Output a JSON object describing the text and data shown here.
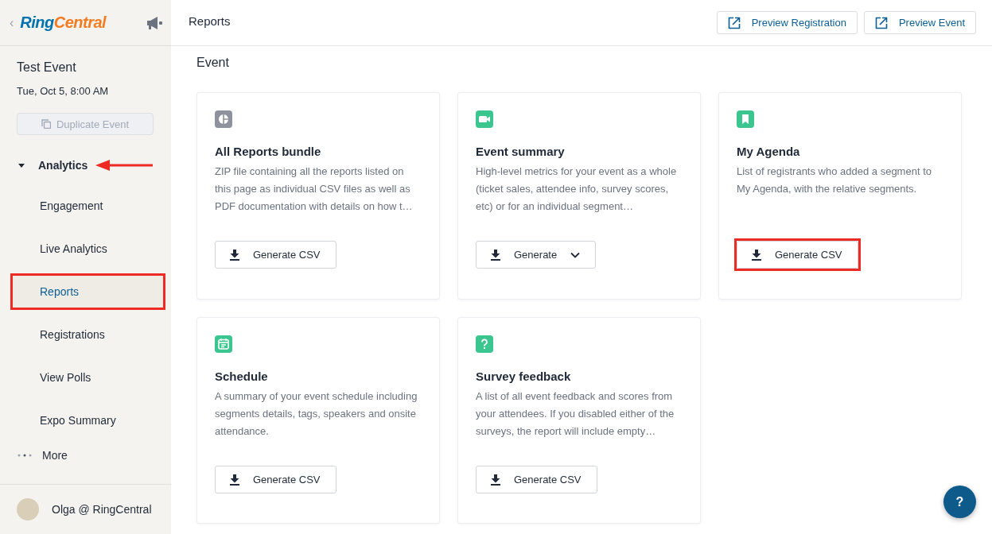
{
  "sidebar": {
    "back_label": "‹",
    "logo": {
      "primary": "Ring",
      "secondary": "Central"
    },
    "event": {
      "title": "Test Event",
      "date": "Tue, Oct 5, 8:00 AM"
    },
    "duplicate_button": {
      "label": "Duplicate Event",
      "disabled": true
    },
    "section": {
      "label": "Analytics",
      "expanded": true,
      "arrow_annotation": true,
      "items": [
        {
          "label": "Engagement",
          "selected": false,
          "annotated": false
        },
        {
          "label": "Live Analytics",
          "selected": false,
          "annotated": false
        },
        {
          "label": "Reports",
          "selected": true,
          "annotated": true
        },
        {
          "label": "Registrations",
          "selected": false,
          "annotated": false
        },
        {
          "label": "View Polls",
          "selected": false,
          "annotated": false
        },
        {
          "label": "Expo Summary",
          "selected": false,
          "annotated": false
        }
      ]
    },
    "more": {
      "label": "More"
    },
    "user": {
      "name": "Olga @ RingCentral"
    }
  },
  "header": {
    "title": "Reports",
    "buttons": [
      {
        "label": "Preview Registration"
      },
      {
        "label": "Preview Event"
      }
    ]
  },
  "section_title": "Event",
  "cards": [
    {
      "title": "All Reports bundle",
      "description": "ZIP file containing all the reports listed on this page as individual CSV files as well as PDF documentation with details on how t…",
      "button": {
        "label": "Generate CSV",
        "dropdown": false,
        "annotated": false
      }
    },
    {
      "title": "Event summary",
      "description": "High-level metrics for your event as a whole (ticket sales, attendee info, survey scores, etc) or for an individual segment…",
      "button": {
        "label": "Generate",
        "dropdown": true,
        "annotated": false
      }
    },
    {
      "title": "My Agenda",
      "description": "List of registrants who added a segment to My Agenda, with the relative segments.",
      "button": {
        "label": "Generate CSV",
        "dropdown": false,
        "annotated": true
      }
    },
    {
      "title": "Schedule",
      "description": "A summary of your event schedule including segments details, tags, speakers and onsite attendance.",
      "button": {
        "label": "Generate CSV",
        "dropdown": false,
        "annotated": false
      }
    },
    {
      "title": "Survey feedback",
      "description": "A list of all event feedback and scores from your attendees. If you disabled either of the surveys, the report will include empty…",
      "button": {
        "label": "Generate CSV",
        "dropdown": false,
        "annotated": false
      }
    }
  ],
  "help_button": {
    "label": "?"
  }
}
